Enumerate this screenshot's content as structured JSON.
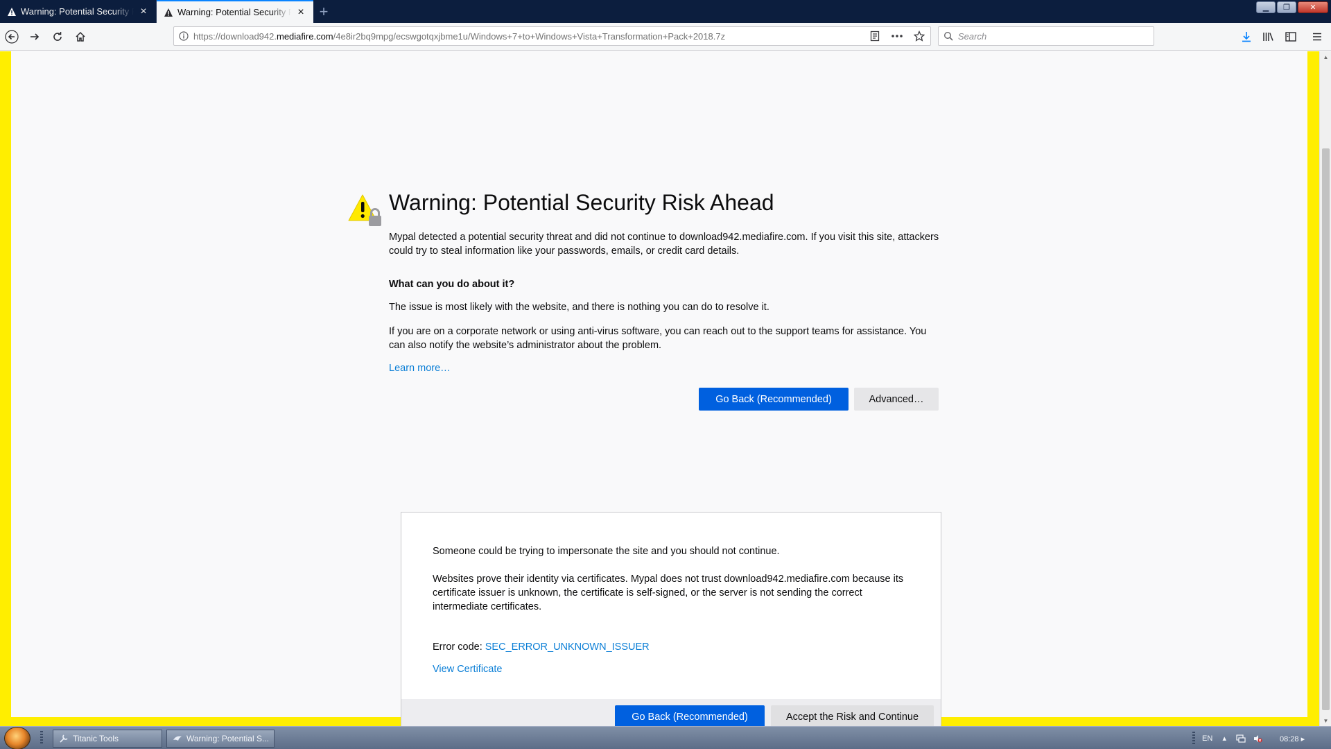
{
  "tabs": [
    {
      "title": "Warning: Potential Security Risk Ahead",
      "active": false
    },
    {
      "title": "Warning: Potential Security Risk Ahead",
      "active": true
    }
  ],
  "navbar": {
    "url_prefix": "https://download942.",
    "url_domain": "mediafire.com",
    "url_path": "/4e8ir2bq9mpg/ecswgotqxjbme1u/Windows+7+to+Windows+Vista+Transformation+Pack+2018.7z",
    "search_placeholder": "Search"
  },
  "warning": {
    "title": "Warning: Potential Security Risk Ahead",
    "intro": "Mypal detected a potential security threat and did not continue to download942.mediafire.com. If you visit this site, attackers could try to steal information like your passwords, emails, or credit card details.",
    "what_heading": "What can you do about it?",
    "para_1": "The issue is most likely with the website, and there is nothing you can do to resolve it.",
    "para_2": "If you are on a corporate network or using anti-virus software, you can reach out to the support teams for assistance. You can also notify the website’s administrator about the problem.",
    "learn_more": "Learn more…",
    "go_back_label": "Go Back (Recommended)",
    "advanced_label": "Advanced…"
  },
  "advanced_panel": {
    "para_1": "Someone could be trying to impersonate the site and you should not continue.",
    "para_2": "Websites prove their identity via certificates. Mypal does not trust download942.mediafire.com because its certificate issuer is unknown, the certificate is self-signed, or the server is not sending the correct intermediate certificates.",
    "error_code_label": "Error code:",
    "error_code": "SEC_ERROR_UNKNOWN_ISSUER",
    "view_certificate": "View Certificate",
    "go_back_label": "Go Back (Recommended)",
    "accept_label": "Accept the Risk and Continue"
  },
  "taskbar": {
    "items": [
      {
        "label": "Titanic Tools"
      },
      {
        "label": "Warning: Potential S..."
      }
    ],
    "language": "EN",
    "clock": "08:28"
  },
  "colors": {
    "page_border": "#ffee00",
    "primary_button": "#0060df",
    "link": "#0a7ed6",
    "tabstrip": "#0c1e3e"
  }
}
